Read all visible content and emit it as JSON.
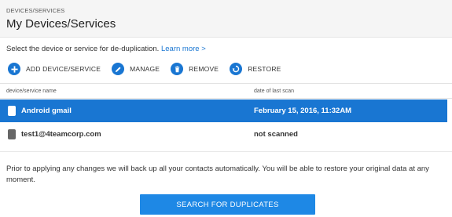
{
  "header": {
    "breadcrumb": "DEVICES/SERVICES",
    "title": "My Devices/Services"
  },
  "intro": {
    "text": "Select the device or service for de-duplication. ",
    "link": "Learn more >"
  },
  "toolbar": [
    {
      "label": "ADD DEVICE/SERVICE",
      "icon": "plus-icon"
    },
    {
      "label": "MANAGE",
      "icon": "pencil-icon"
    },
    {
      "label": "REMOVE",
      "icon": "trash-icon"
    },
    {
      "label": "RESTORE",
      "icon": "restore-icon"
    }
  ],
  "table": {
    "columns": [
      "device/service name",
      "date of last scan"
    ],
    "rows": [
      {
        "name": "Android gmail",
        "last_scan": "February 15, 2016, 11:32AM",
        "selected": true,
        "icon": "android-icon"
      },
      {
        "name": "test1@4teamcorp.com",
        "last_scan": "not scanned",
        "selected": false,
        "icon": "windows-icon"
      }
    ]
  },
  "note": "Prior to applying any changes we will back up all your contacts automatically. You will be able to restore your original data at any moment.",
  "search_button": "SEARCH FOR DUPLICATES",
  "colors": {
    "accent": "#1976d2",
    "button": "#1e88e5",
    "header_bg": "#f5f5f5"
  }
}
